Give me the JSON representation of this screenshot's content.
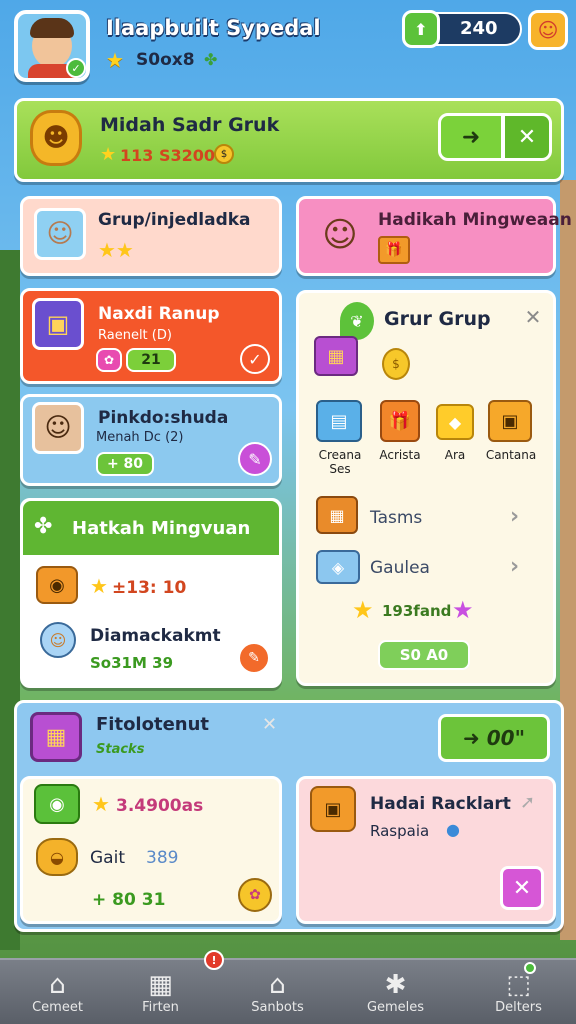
{
  "header": {
    "player_name": "Ilaapbuilt Sypedal",
    "score": "S0ox8",
    "counter": "240",
    "star_icon": "star-icon"
  },
  "banner": {
    "title": "Midah Sadr Gruk",
    "values": "113 S3200",
    "confirm": "➜",
    "close": "✕"
  },
  "card_group": {
    "title": "Grup/injedladka",
    "stars": "★★"
  },
  "card_pink": {
    "title": "Hadikah Mingweaan"
  },
  "card_orange": {
    "title": "Naxdi Ranup",
    "subtitle": "Raenelt (D)",
    "count": "21"
  },
  "card_blue": {
    "title": "Pinkdo:shuda",
    "subtitle": "Menah Dc (2)",
    "count": "+ 80"
  },
  "right_panel": {
    "title": "Grur Grup",
    "items": [
      {
        "label": "Creana Ses"
      },
      {
        "label": "Acrista"
      },
      {
        "label": "Ara"
      },
      {
        "label": "Cantana"
      }
    ],
    "row1": "Tasms",
    "row2": "Gaulea",
    "reward": "193fand",
    "button": "S0 A0"
  },
  "weekly": {
    "title": "Hatkah Mingvuan",
    "reward1": "±13: 10",
    "reward2_title": "Diamackakmt",
    "reward2_value": "So31M 39"
  },
  "bottom_panel": {
    "title": "Fitolotenut",
    "subtitle": "Stacks",
    "action": "00\"",
    "row1": "3.4900as",
    "row2_label": "Gait",
    "row2_value": "389",
    "row3": "+ 80 31",
    "pink_title": "Hadai Racklart",
    "pink_sub": "Raspaia"
  },
  "nav": [
    {
      "label": "Cemeet"
    },
    {
      "label": "Firten"
    },
    {
      "label": "Sanbots"
    },
    {
      "label": "Gemeles"
    },
    {
      "label": "Delters"
    }
  ],
  "nav_badge": "!"
}
